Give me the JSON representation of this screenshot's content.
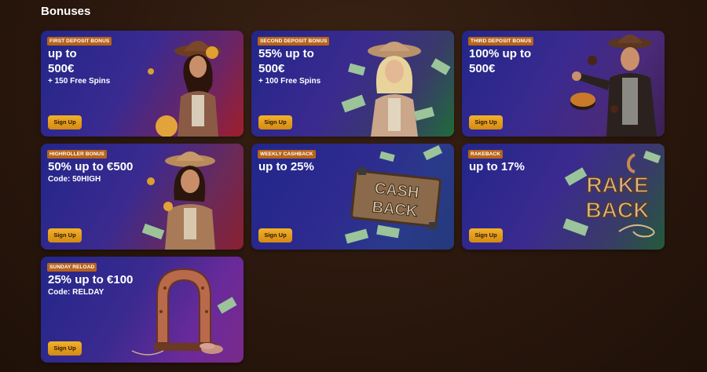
{
  "section": {
    "title": "Bonuses"
  },
  "cards": [
    {
      "badge": "FIRST DEPOSIT BONUS",
      "title_line1": "up to",
      "title_line2": "500€",
      "sub": "+ 150 Free Spins",
      "button": "Sign Up"
    },
    {
      "badge": "SECOND DEPOSIT BONUS",
      "title_line1": "55% up to",
      "title_line2": "500€",
      "sub": "+ 100 Free Spins",
      "button": "Sign Up"
    },
    {
      "badge": "THIRD DEPOSIT BONUS",
      "title_line1": "100% up to",
      "title_line2": "500€",
      "sub": "",
      "button": "Sign Up"
    },
    {
      "badge": "HIGHROLLER BONUS",
      "title_line1": "50% up to €500",
      "title_line2": "",
      "sub": "Code: 50HIGH",
      "button": "Sign Up"
    },
    {
      "badge": "WEEKLY CASHBACK",
      "title_line1": "up to 25%",
      "title_line2": "",
      "sub": "",
      "button": "Sign Up",
      "art_text": [
        "CASH",
        "BACK"
      ]
    },
    {
      "badge": "RAKEBACK",
      "title_line1": "up to 17%",
      "title_line2": "",
      "sub": "",
      "button": "Sign Up",
      "art_text": [
        "RAKE",
        "BACK"
      ]
    },
    {
      "badge": "SUNDAY RELOAD",
      "title_line1": "25% up to €100",
      "title_line2": "",
      "sub": "Code: RELDAY",
      "button": "Sign Up"
    }
  ],
  "colors": {
    "badge": "#b8641a",
    "button": "#f1b12a",
    "background": "#2a170d"
  }
}
